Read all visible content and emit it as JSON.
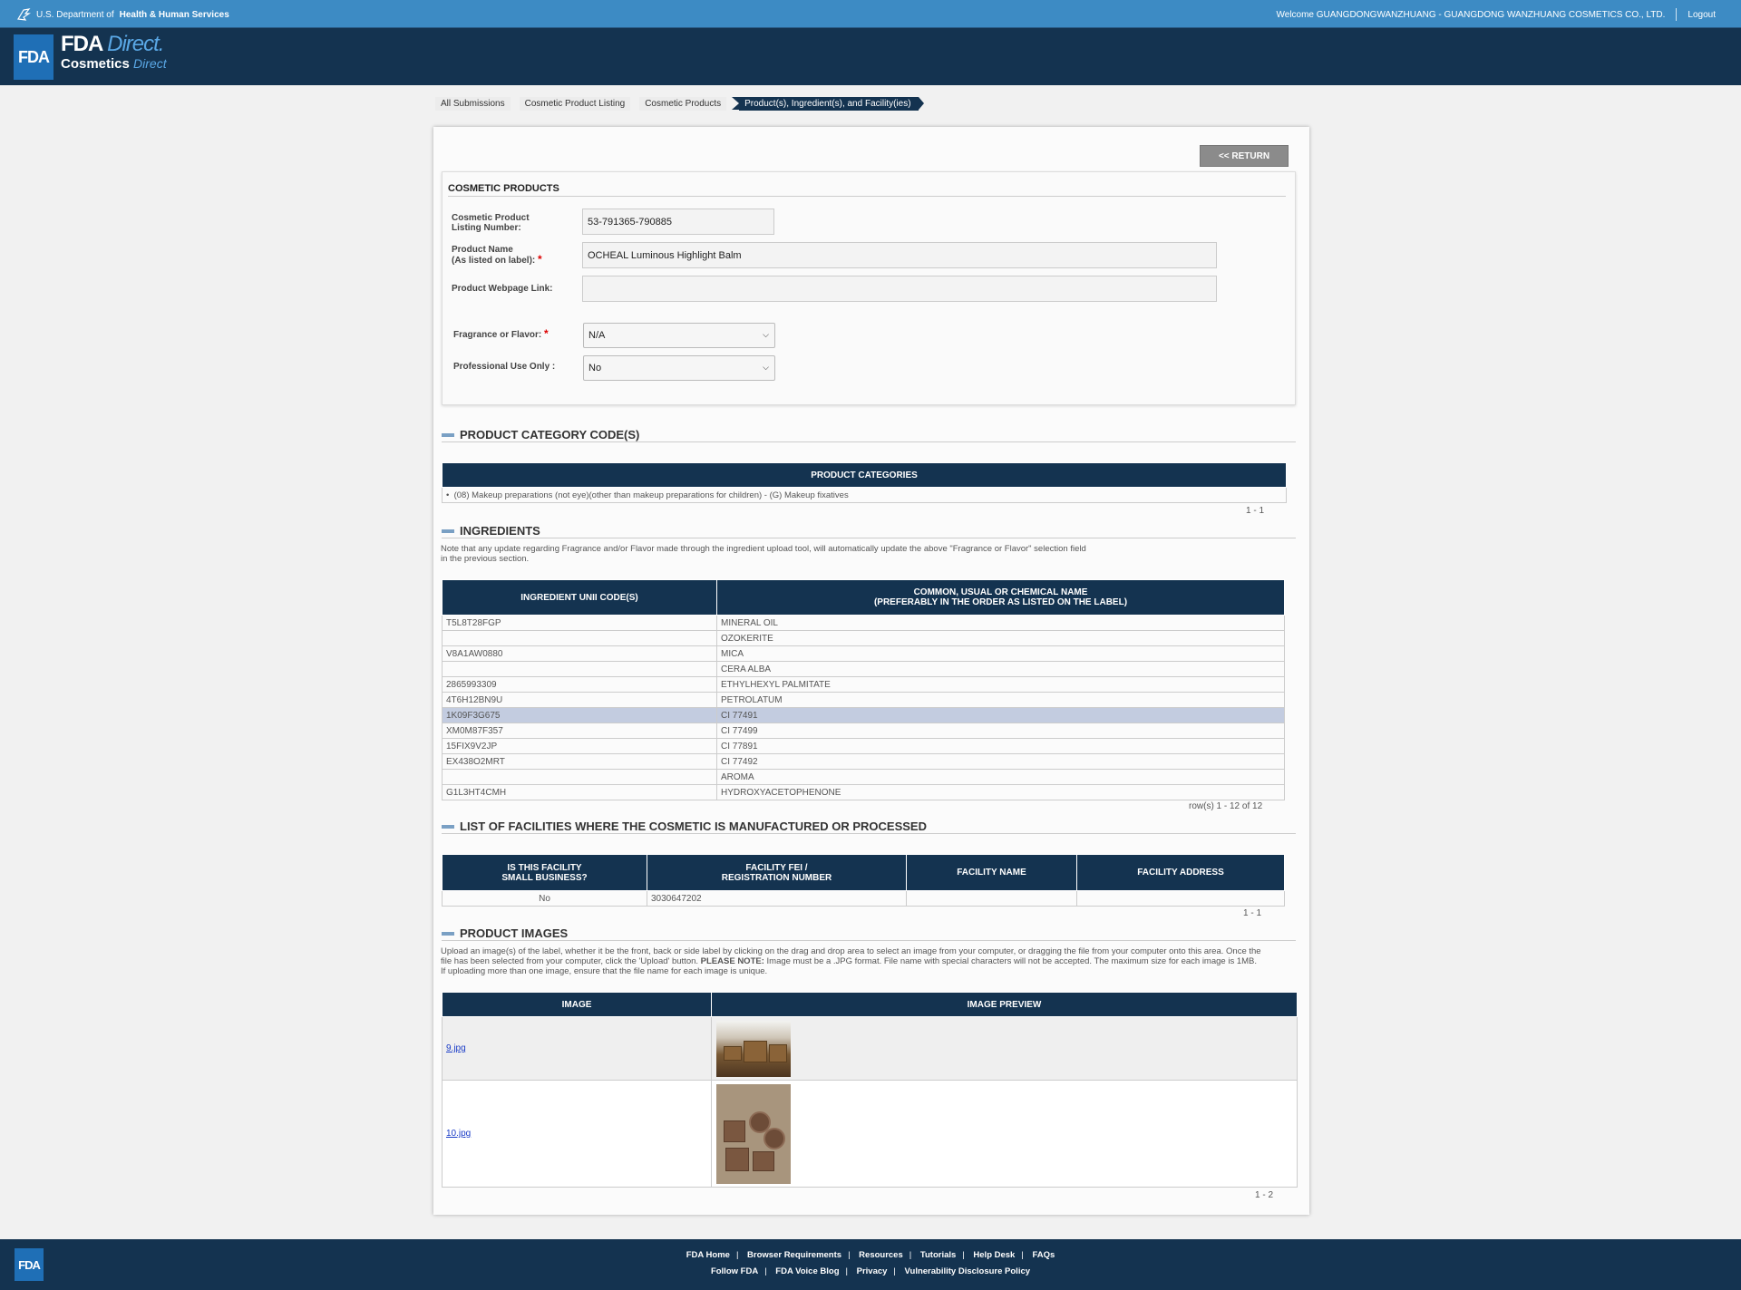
{
  "hhs": {
    "prefix": "U.S. Department of",
    "bold": "Health & Human Services",
    "welcome": "Welcome GUANGDONGWANZHUANG - GUANGDONG WANZHUANG COSMETICS CO., LTD.",
    "logout": "Logout"
  },
  "brand": {
    "logo": "FDA",
    "fda": "FDA",
    "direct": "Direct.",
    "cosmetics": "Cosmetics",
    "direct2": "Direct"
  },
  "breadcrumb": [
    "All Submissions",
    "Cosmetic Product Listing",
    "Cosmetic Products",
    "Product(s), Ingredient(s), and Facility(ies)"
  ],
  "return_label": "<< RETURN",
  "cosmetic_products": {
    "title": "COSMETIC PRODUCTS",
    "listing_label_1": "Cosmetic Product",
    "listing_label_2": "Listing Number:",
    "listing_value": "53-791365-790885",
    "name_label_1": "Product Name",
    "name_label_2": "(As listed on label):",
    "name_value": "OCHEAL Luminous Highlight Balm",
    "webpage_label": "Product Webpage Link:",
    "webpage_value": "",
    "fragrance_label": "Fragrance or Flavor:",
    "fragrance_value": "N/A",
    "professional_label": "Professional Use Only :",
    "professional_value": "No",
    "required_mark": "*"
  },
  "category_section": {
    "title": "PRODUCT CATEGORY CODE(S)",
    "header": "PRODUCT CATEGORIES",
    "item": "(08) Makeup preparations (not eye)(other than makeup preparations for children) - (G) Makeup fixatives",
    "pager": "1 - 1"
  },
  "ingredients": {
    "title": "INGREDIENTS",
    "note_1": "Note that any update regarding Fragrance and/or Flavor made through the ingredient upload tool, will automatically update the above \"Fragrance or Flavor\" selection field",
    "note_2": "in the previous section.",
    "col1": "INGREDIENT UNII CODE(S)",
    "col2_1": "COMMON, USUAL OR CHEMICAL NAME",
    "col2_2": "(PREFERABLY IN THE ORDER AS LISTED ON THE LABEL)",
    "rows": [
      {
        "code": "T5L8T28FGP",
        "name": "MINERAL OIL"
      },
      {
        "code": "",
        "name": "OZOKERITE"
      },
      {
        "code": "V8A1AW0880",
        "name": "MICA"
      },
      {
        "code": "",
        "name": "CERA ALBA"
      },
      {
        "code": "2865993309",
        "name": "ETHYLHEXYL PALMITATE"
      },
      {
        "code": "4T6H12BN9U",
        "name": "PETROLATUM"
      },
      {
        "code": "1K09F3G675",
        "name": "CI 77491"
      },
      {
        "code": "XM0M87F357",
        "name": "CI 77499"
      },
      {
        "code": "15FIX9V2JP",
        "name": "CI 77891"
      },
      {
        "code": "EX438O2MRT",
        "name": "CI 77492"
      },
      {
        "code": "",
        "name": "AROMA"
      },
      {
        "code": "G1L3HT4CMH",
        "name": "HYDROXYACETOPHENONE"
      }
    ],
    "pager": "row(s) 1 - 12 of 12"
  },
  "facilities": {
    "title": "LIST OF FACILITIES WHERE THE COSMETIC IS MANUFACTURED OR PROCESSED",
    "col1_1": "IS THIS FACILITY",
    "col1_2": "SMALL BUSINESS?",
    "col2_1": "FACILITY FEI /",
    "col2_2": "REGISTRATION NUMBER",
    "col3": "FACILITY NAME",
    "col4": "FACILITY ADDRESS",
    "row": {
      "small": "No",
      "fei": "3030647202",
      "name": "",
      "address": ""
    },
    "pager": "1 - 1"
  },
  "images": {
    "title": "PRODUCT IMAGES",
    "note_1": "Upload an image(s) of the label, whether it be the front, back or side label by clicking on the drag and drop area to select an image from your computer, or dragging the file from your computer onto this area. Once the",
    "note_2a": "file has been selected from your computer, click the 'Upload' button. ",
    "note_2b": "PLEASE NOTE:",
    "note_2c": " Image must be a .JPG format. File name with special characters will not be accepted. The maximum size for each image is 1MB.",
    "note_3": "If uploading more than one image, ensure that the file name for each image is unique.",
    "col1": "IMAGE",
    "col2": "IMAGE PREVIEW",
    "files": [
      "9.jpg",
      "10.jpg"
    ],
    "pager": "1 - 2"
  },
  "footer": {
    "logo": "FDA",
    "row1": [
      "FDA Home",
      "Browser Requirements",
      "Resources",
      "Tutorials",
      "Help Desk",
      "FAQs"
    ],
    "row2": [
      "Follow FDA",
      "FDA Voice Blog",
      "Privacy",
      "Vulnerability Disclosure Policy"
    ]
  },
  "colors": {
    "header_blue": "#3d8bc4",
    "navy": "#143350",
    "selected_row": "#c3cce0"
  }
}
